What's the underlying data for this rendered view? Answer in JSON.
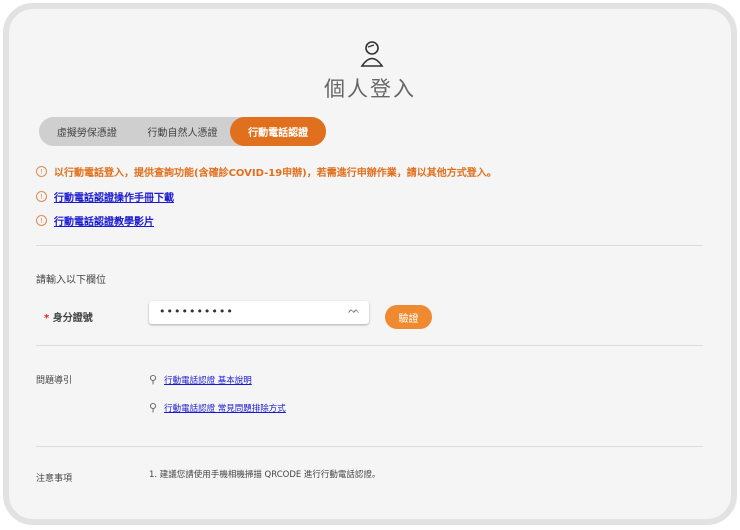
{
  "header": {
    "title": "個人登入",
    "icon": "user-icon"
  },
  "tabs": [
    {
      "label": "虛擬勞保憑證"
    },
    {
      "label": "行動自然人憑證"
    },
    {
      "label": "行動電話認證",
      "active": true
    }
  ],
  "notices": {
    "warning": "以行動電話登入，提供查詢功能(含確診COVID-19申辦)，若需進行申辦作業，請以其他方式登入。",
    "manual_link": "行動電話認證操作手冊下載",
    "video_link": "行動電話認證教學影片"
  },
  "form": {
    "section_title": "請輸入以下欄位",
    "required_mark": "*",
    "id_label": "身分證號",
    "id_value": "••••••••••",
    "verify_button": "驗證"
  },
  "help": {
    "label": "問題導引",
    "links": [
      "行動電話認證 基本說明",
      "行動電話認證 常見問題排除方式"
    ]
  },
  "notes": {
    "label": "注意事項",
    "items": [
      "1.  建議您請使用手機相機掃描 QRCODE 進行行動電話認證。"
    ]
  },
  "colors": {
    "accent": "#e0701d",
    "button": "#ef8a30",
    "link": "#1a1ad0"
  }
}
